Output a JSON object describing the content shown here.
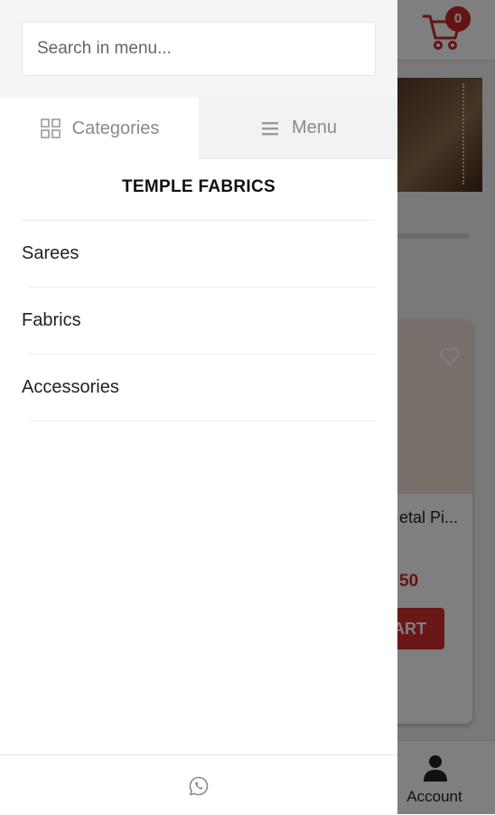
{
  "search": {
    "placeholder": "Search in menu..."
  },
  "tabs": [
    {
      "label": "Categories",
      "icon": "grid-icon",
      "active": true
    },
    {
      "label": "Menu",
      "icon": "hamburger-icon",
      "active": false
    }
  ],
  "drawer": {
    "title": "TEMPLE FABRICS",
    "items": [
      {
        "label": "Sarees"
      },
      {
        "label": "Fabrics"
      },
      {
        "label": "Accessories"
      }
    ],
    "footer_icon": "whatsapp-icon"
  },
  "background": {
    "cart_count": "0",
    "product_name": "etal Pi...",
    "product_price": "50",
    "add_button_label": "ART",
    "account_label": "Account"
  },
  "colors": {
    "accent": "#c62828",
    "muted": "#8a8a8a"
  }
}
